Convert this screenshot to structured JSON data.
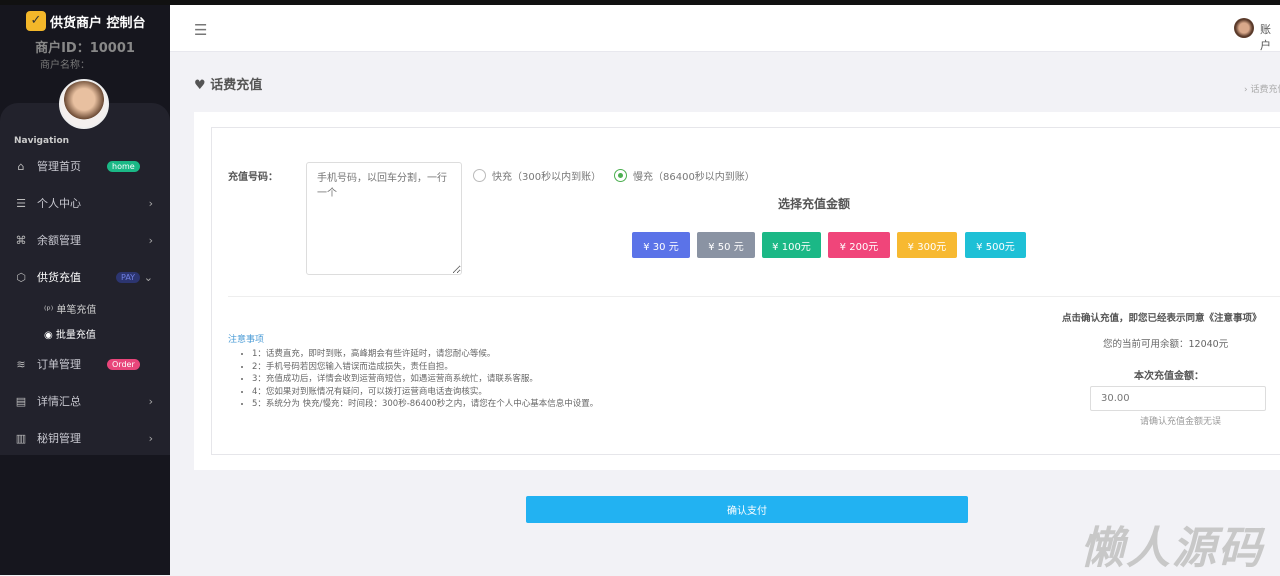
{
  "sidebar": {
    "brand": "供货商户 控制台",
    "merchant_id": "商户ID：10001",
    "merchant_name": "商户名称：",
    "nav_title": "Navigation",
    "items": [
      {
        "label": "管理首页",
        "badge": "home"
      },
      {
        "label": "个人中心"
      },
      {
        "label": "余额管理"
      },
      {
        "label": "供货充值",
        "badge": "PAY"
      },
      {
        "label": "订单管理",
        "badge": "Order"
      },
      {
        "label": "详情汇总"
      },
      {
        "label": "秘钥管理"
      }
    ],
    "sub_items": [
      "单笔充值",
      "批量充值"
    ]
  },
  "header": {
    "account": "账户"
  },
  "page": {
    "title": "话费充值",
    "breadcrumb": "›  话费充值"
  },
  "form": {
    "number_label": "充值号码：",
    "number_placeholder": "手机号码，以回车分割，一行一个",
    "radios": [
      {
        "label": "快充（300秒以内到账）",
        "checked": false
      },
      {
        "label": "慢充（86400秒以内到账）",
        "checked": true
      }
    ],
    "choose_title": "选择充值金额",
    "amounts": [
      {
        "label": "¥ 30 元",
        "color": "#5b73e8"
      },
      {
        "label": "¥ 50 元",
        "color": "#8a93a3"
      },
      {
        "label": "¥ 100元",
        "color": "#1bb886"
      },
      {
        "label": "¥ 200元",
        "color": "#f0457a"
      },
      {
        "label": "¥ 300元",
        "color": "#f7b931"
      },
      {
        "label": "¥ 500元",
        "color": "#1ec0d6"
      }
    ],
    "notes_title": "注意事项",
    "notes": [
      "1：话费直充，即时到账，高峰期会有些许延时，请您耐心等候。",
      "2：手机号码若因您输入错误而造成损失，责任自担。",
      "3：充值成功后，详情会收到运营商短信，如遇运营商系统忙，请联系客服。",
      "4：您如果对到账情况有疑问，可以拨打运营商电话查询核实。",
      "5：系统分为 快充/慢充：时间段：300秒-86400秒之内，请您在个人中心基本信息中设置。"
    ],
    "agree_text": "点击确认充值，即您已经表示同意《注意事项》",
    "balance": "您的当前可用余额：12040元",
    "this_amount_label": "本次充值金额：",
    "this_amount_value": "30.00",
    "confirm_hint": "请确认充值金额无误"
  },
  "pay_button": "确认支付",
  "watermark": "懒人源码"
}
